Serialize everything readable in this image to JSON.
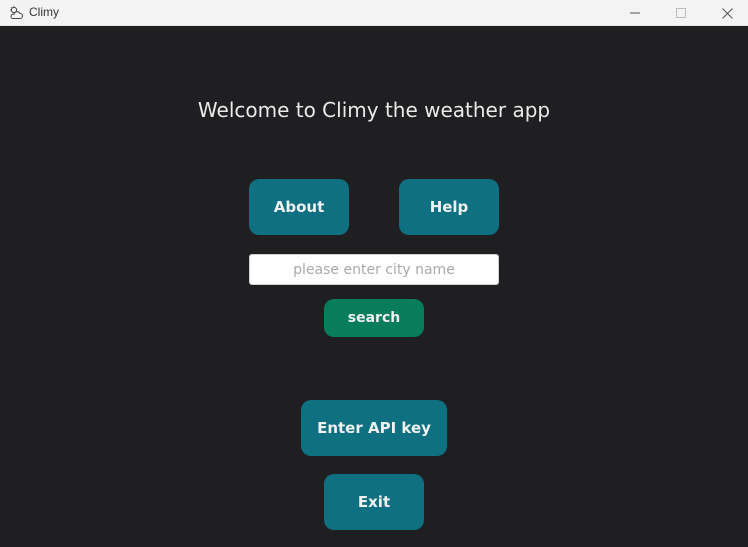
{
  "window": {
    "title": "Climy",
    "icon": "cloud-sun-icon"
  },
  "main": {
    "welcome_text": "Welcome to Climy the weather app",
    "about_label": "About",
    "help_label": "Help",
    "city_input": {
      "value": "",
      "placeholder": "please enter city name"
    },
    "search_label": "search",
    "api_key_label": "Enter API key",
    "exit_label": "Exit"
  },
  "colors": {
    "background": "#1f1f22",
    "teal_button": "#0e7081",
    "green_button": "#077d5c"
  }
}
